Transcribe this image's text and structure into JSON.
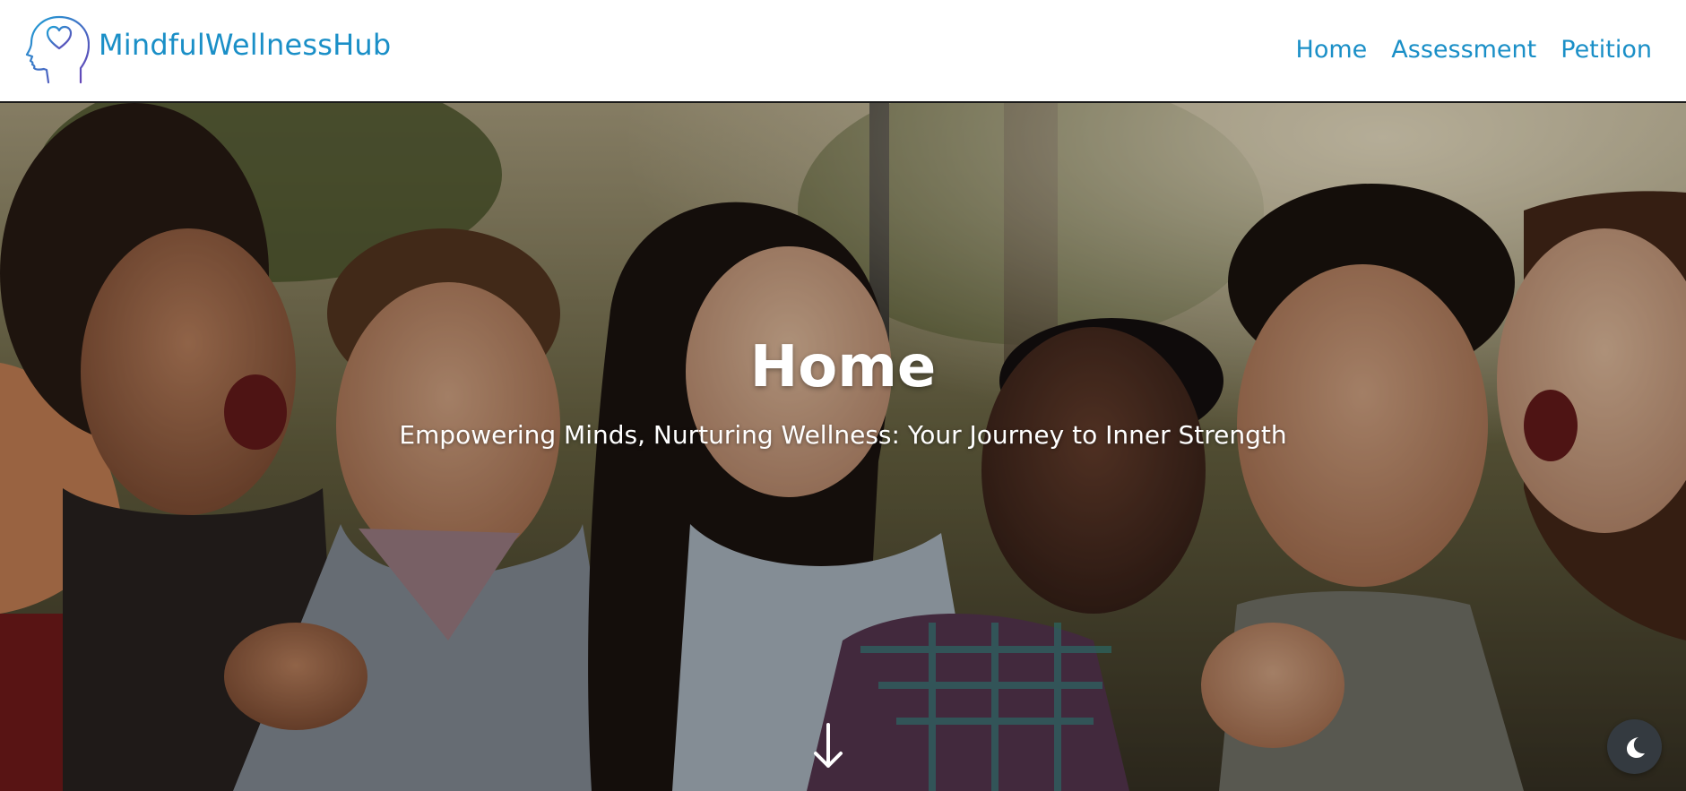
{
  "brand": {
    "name": "MindfulWellnessHub",
    "logo_icon": "head-heart-icon",
    "colors": {
      "brand": "#1a8fc7",
      "logo_gradient_start": "#1aa3d6",
      "logo_gradient_end": "#6a3fb5"
    }
  },
  "nav": {
    "items": [
      {
        "label": "Home"
      },
      {
        "label": "Assessment"
      },
      {
        "label": "Petition"
      }
    ],
    "color": "#1a8fc7"
  },
  "hero": {
    "title": "Home",
    "subtitle": "Empowering Minds, Nurturing Wellness: Your Journey to Inner Strength",
    "background_image": "group-of-laughing-friends-photo",
    "scroll_icon": "arrow-down-icon"
  },
  "theme_toggle": {
    "icon": "moon-icon",
    "background": "#343a40"
  }
}
